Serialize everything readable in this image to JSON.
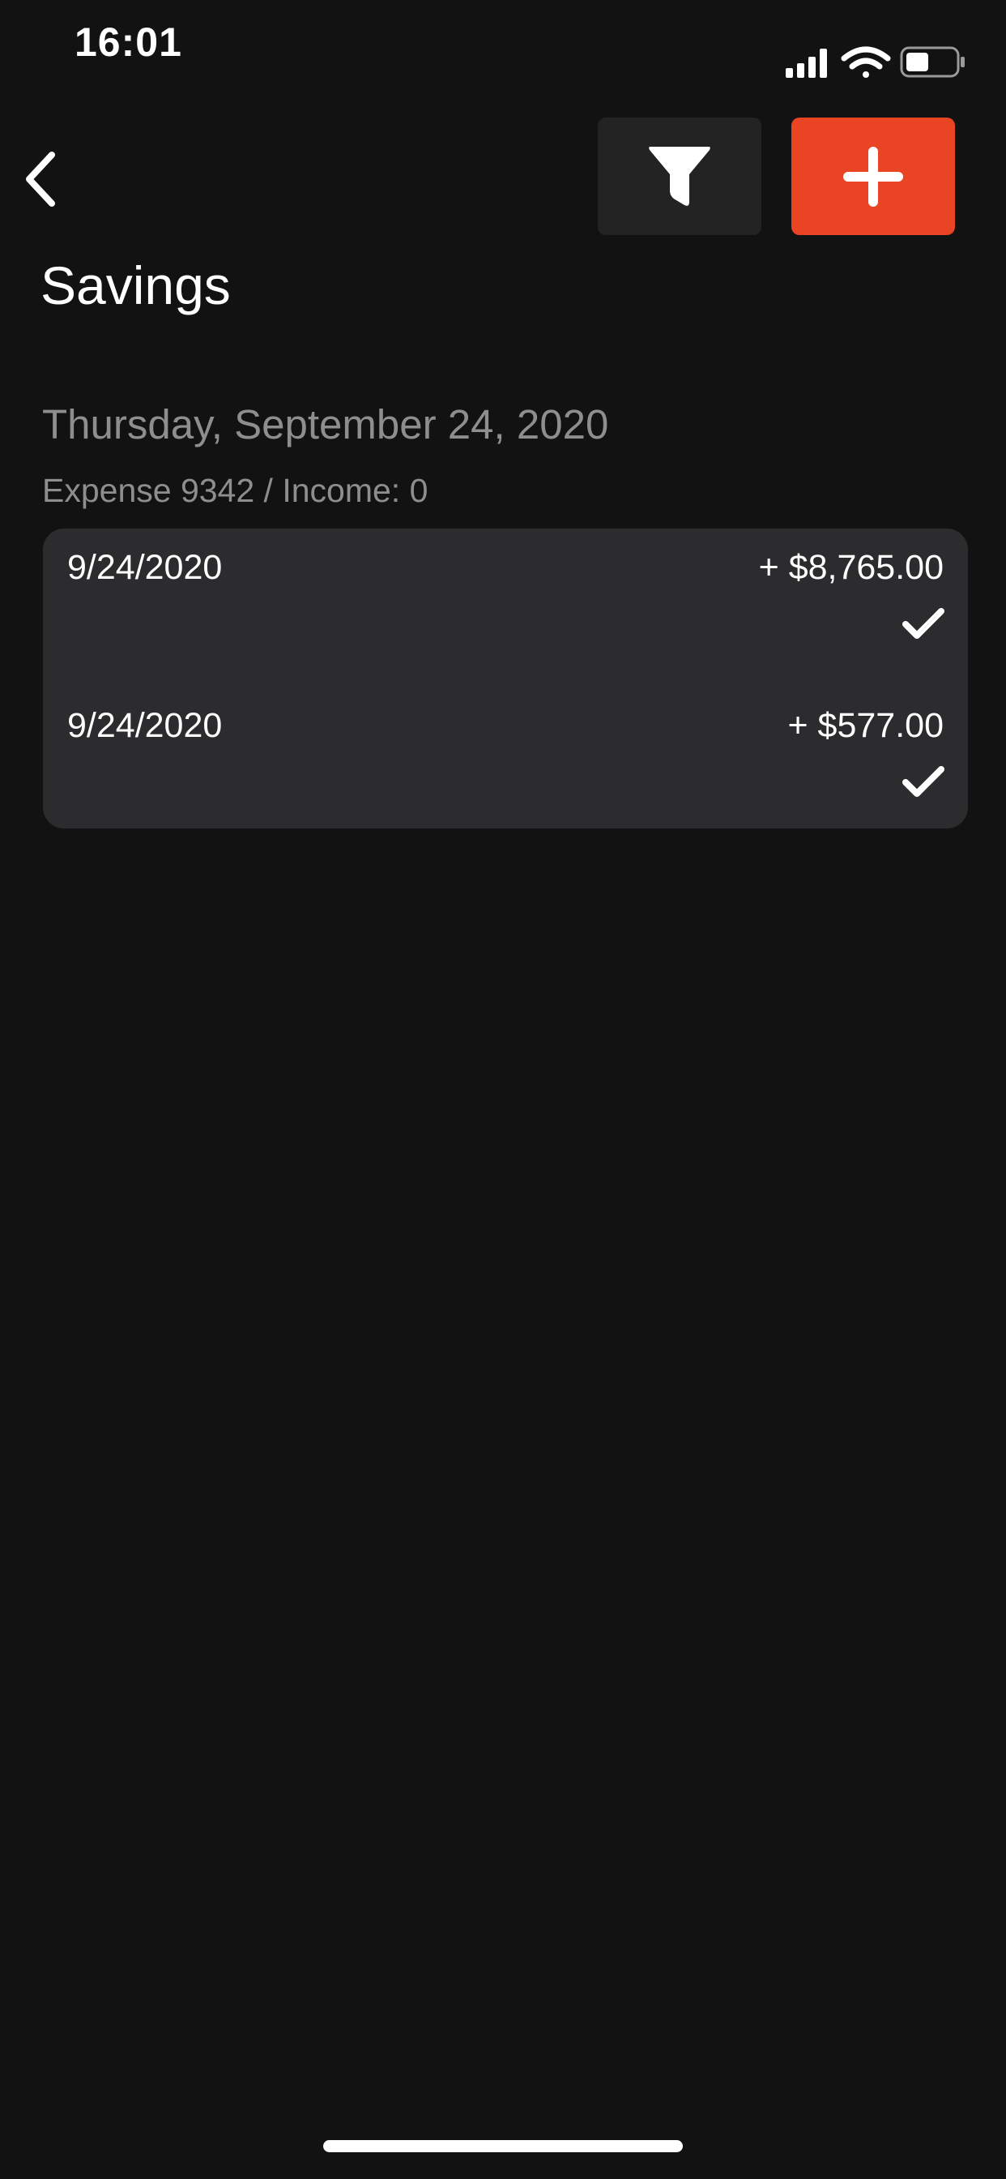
{
  "status_bar": {
    "time": "16:01",
    "icons": [
      "signal-icon",
      "wifi-icon",
      "battery-icon"
    ]
  },
  "nav": {
    "back_icon": "chevron-left-icon",
    "filter_icon": "filter-icon",
    "add_icon": "plus-icon",
    "colors": {
      "filter_bg": "#232323",
      "add_bg": "#e94525"
    }
  },
  "page": {
    "title": "Savings"
  },
  "groups": [
    {
      "heading": "Thursday, September 24, 2020",
      "summary": "Expense 9342 / Income: 0",
      "transactions": [
        {
          "date": "9/24/2020",
          "amount": "+ $8,765.00",
          "status_icon": "checkmark-icon"
        },
        {
          "date": "9/24/2020",
          "amount": "+ $577.00",
          "status_icon": "checkmark-icon"
        }
      ]
    }
  ]
}
